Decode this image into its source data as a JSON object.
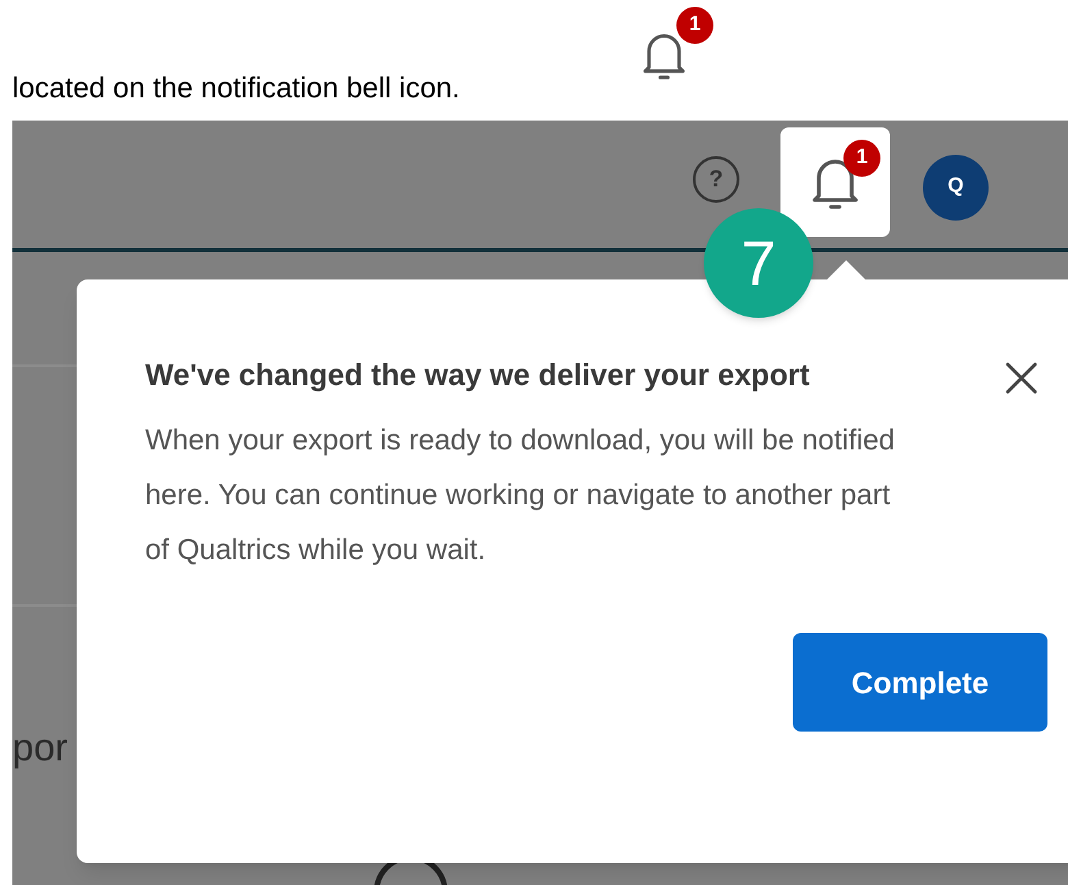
{
  "doc": {
    "text": "located on the notification bell icon.",
    "bell_badge": "1"
  },
  "screenshot": {
    "header": {
      "help_glyph": "?",
      "bell_selected": true,
      "notification_badge": "1",
      "avatar_initial": "Q"
    },
    "step_marker": "7",
    "background_text": "por",
    "popover": {
      "title": "We've changed the way we deliver your export",
      "body": "When your export is ready to download, you will be notified here. You can continue working or navigate to another part of Qualtrics while you wait.",
      "button": "Complete"
    }
  }
}
